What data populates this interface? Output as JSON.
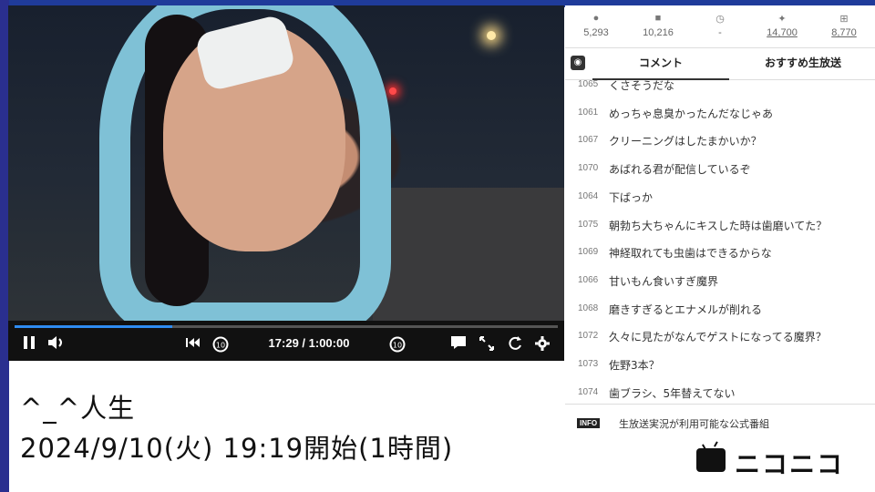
{
  "player": {
    "time_display": "17:29 / 1:00:00",
    "progress": 0.29
  },
  "stats": [
    {
      "icon": "person-icon",
      "glyph": "●",
      "value": "5,293",
      "link": false
    },
    {
      "icon": "comment-icon",
      "glyph": "■",
      "value": "10,216",
      "link": false
    },
    {
      "icon": "clock-icon",
      "glyph": "◷",
      "value": "-",
      "link": false
    },
    {
      "icon": "party-popper-icon",
      "glyph": "✦",
      "value": "14,700",
      "link": true
    },
    {
      "icon": "gift-icon",
      "glyph": "⊞",
      "value": "8,770",
      "link": true
    }
  ],
  "tabs": {
    "comment": "コメント",
    "recommend": "おすすめ生放送"
  },
  "comments": [
    {
      "num": "1065",
      "text": "くさそうだな"
    },
    {
      "num": "1061",
      "text": "めっちゃ息臭かったんだなじゃあ"
    },
    {
      "num": "1067",
      "text": "クリーニングはしたまかいか？"
    },
    {
      "num": "1070",
      "text": "あばれる君が配信しているぞ"
    },
    {
      "num": "1064",
      "text": "下ばっか"
    },
    {
      "num": "1075",
      "text": "朝勃ち大ちゃんにキスした時は歯磨いてた？"
    },
    {
      "num": "1069",
      "text": "神経取れても虫歯はできるからな"
    },
    {
      "num": "1066",
      "text": "甘いもん食いすぎ魔界"
    },
    {
      "num": "1068",
      "text": "磨きすぎるとエナメルが削れる"
    },
    {
      "num": "1072",
      "text": "久々に見たがなんでゲストになってる魔界？"
    },
    {
      "num": "1073",
      "text": "佐野3本？"
    },
    {
      "num": "1074",
      "text": "歯ブラシ、5年替えてない"
    }
  ],
  "info": {
    "badge": "INFO",
    "text": "生放送実況が利用可能な公式番組"
  },
  "overlay": {
    "title": "^_^人生",
    "date": "2024/9/10(火) 19:19開始(1時間)"
  },
  "logo": {
    "text": "ニコニコ"
  }
}
